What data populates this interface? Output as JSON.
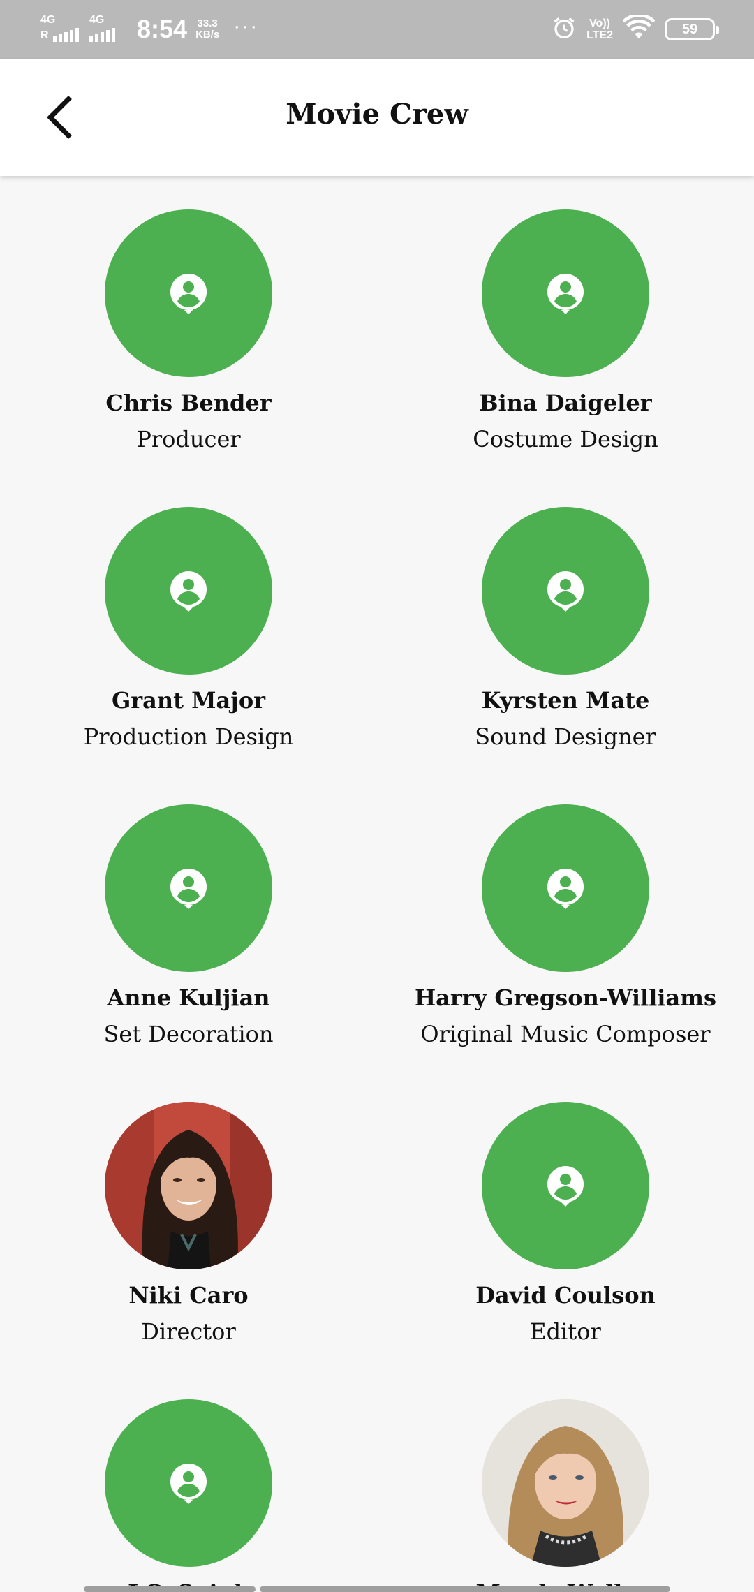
{
  "status_bar": {
    "net1": "4G",
    "net1_sub": "R",
    "net2": "4G",
    "time": "8:54",
    "speed_value": "33.3",
    "speed_unit": "KB/s",
    "more": "···",
    "volte_top": "Vo))",
    "volte_bottom": "LTE2",
    "battery": "59"
  },
  "header": {
    "title": "Movie Crew"
  },
  "crew": [
    {
      "name": "Chris Bender",
      "role": "Producer",
      "photo": "placeholder"
    },
    {
      "name": "Bina Daigeler",
      "role": "Costume Design",
      "photo": "placeholder"
    },
    {
      "name": "Grant Major",
      "role": "Production Design",
      "photo": "placeholder"
    },
    {
      "name": "Kyrsten Mate",
      "role": "Sound Designer",
      "photo": "placeholder"
    },
    {
      "name": "Anne Kuljian",
      "role": "Set Decoration",
      "photo": "placeholder"
    },
    {
      "name": "Harry Gregson-Williams",
      "role": "Original Music Composer",
      "photo": "placeholder"
    },
    {
      "name": "Niki Caro",
      "role": "Director",
      "photo": "portrait-dark-hair"
    },
    {
      "name": "David Coulson",
      "role": "Editor",
      "photo": "placeholder"
    },
    {
      "name": "J.C. Spink",
      "role": "",
      "photo": "placeholder"
    },
    {
      "name": "Mandy Walker",
      "role": "",
      "photo": "portrait-blonde"
    }
  ],
  "colors": {
    "accent": "#4caf50",
    "background": "#f7f7f7",
    "status_bar": "#b9b9b9"
  },
  "icons": {
    "back": "arrow-back-icon",
    "placeholder": "person-pin-icon",
    "alarm": "alarm-icon",
    "wifi": "wifi-icon",
    "battery": "battery-icon"
  }
}
